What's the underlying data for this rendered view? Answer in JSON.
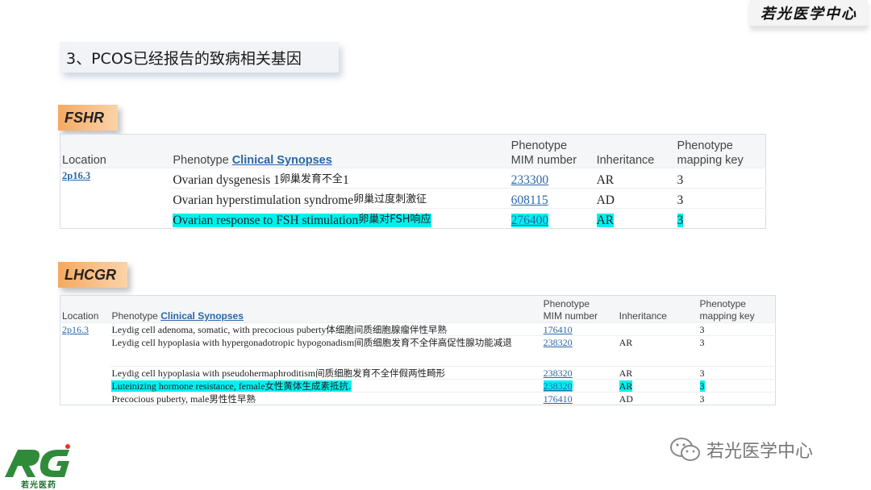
{
  "brand": {
    "name": "若光医学中心"
  },
  "title": "3、PCOS已经报告的致病相关基因",
  "colors": {
    "highlight": "#00f0f0",
    "link": "#2a67a8",
    "label_orange": "#f6a961"
  },
  "fshr": {
    "gene": "FSHR",
    "headers": {
      "location": "Location",
      "phenotype": "Phenotype",
      "clinical": "Clinical Synopses",
      "mim_1": "Phenotype",
      "mim_2": "MIM number",
      "inheritance": "Inheritance",
      "key_1": "Phenotype",
      "key_2": "mapping key"
    },
    "location": "2p16.3",
    "rows": [
      {
        "phenotype": "Ovarian dysgenesis 1",
        "zh": "卵巢发育不全",
        "suffix": "1",
        "mim": "233300",
        "inheritance": "AR",
        "key": "3",
        "highlight": false
      },
      {
        "phenotype": "Ovarian hyperstimulation syndrome",
        "zh": "卵巢过度刺激征",
        "suffix": "",
        "mim": "608115",
        "inheritance": "AD",
        "key": "3",
        "highlight": false
      },
      {
        "phenotype": "Ovarian response to FSH stimulation",
        "zh": "卵巢对FSH响应",
        "suffix": "",
        "mim": "276400",
        "inheritance": "AR",
        "key": "3",
        "highlight": true
      }
    ]
  },
  "lhcgr": {
    "gene": "LHCGR",
    "headers": {
      "location": "Location",
      "phenotype": "Phenotype",
      "clinical": "Clinical Synopses",
      "mim_1": "Phenotype",
      "mim_2": "MIM number",
      "inheritance": "Inheritance",
      "key_1": "Phenotype",
      "key_2": "mapping key"
    },
    "location": "2p16.3",
    "rows": [
      {
        "phenotype": "Leydig cell adenoma, somatic, with precocious puberty",
        "zh": "体细胞间质细胞腺瘤伴性早熟",
        "mim": "176410",
        "inheritance": "",
        "key": "3",
        "highlight": false
      },
      {
        "phenotype": "Leydig cell hypoplasia with hypergonadotropic hypogonadism",
        "zh": "间质细胞发育不全伴高促性腺功能减退",
        "mim": "238320",
        "inheritance": "AR",
        "key": "3",
        "highlight": false
      },
      {
        "phenotype": "Leydig cell hypoplasia with pseudohermaphroditism",
        "zh": "间质细胞发育不全伴假两性畸形",
        "mim": "238320",
        "inheritance": "AR",
        "key": "3",
        "highlight": false
      },
      {
        "phenotype": "Luteinizing hormone resistance, female",
        "zh": "女性黄体生成素抵抗.",
        "mim": "238320",
        "inheritance": "AR",
        "key": "3",
        "highlight": true
      },
      {
        "phenotype": "Precocious puberty, male",
        "zh": "男性性早熟",
        "mim": "176410",
        "inheritance": "AD",
        "key": "3",
        "highlight": false
      }
    ]
  },
  "logo": {
    "text": "若光医药"
  },
  "watermark": {
    "text": "若光医学中心",
    "icon": "wechat-icon"
  }
}
